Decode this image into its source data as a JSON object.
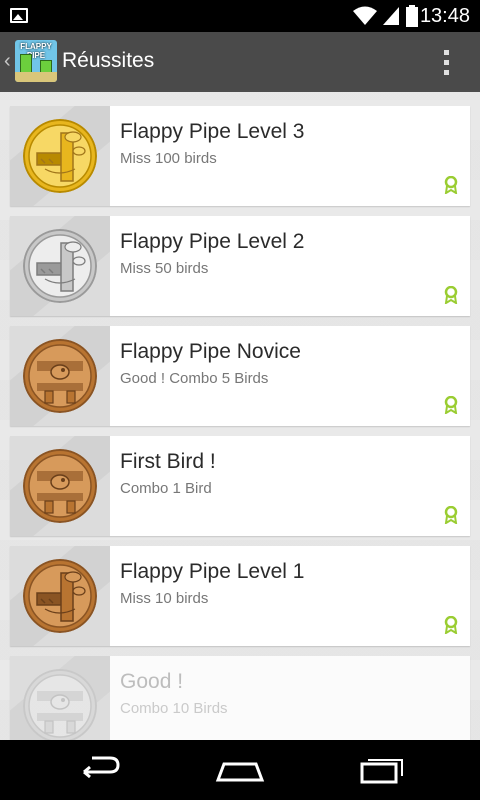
{
  "status_bar": {
    "time": "13:48",
    "icons": [
      "image-notification-icon",
      "wifi-icon",
      "signal-icon",
      "battery-icon"
    ]
  },
  "action_bar": {
    "title": "Réussites",
    "app_icon_text": "FLAPPY PIPE",
    "icons": [
      "up-caret-icon",
      "app-icon",
      "overflow-menu-icon"
    ]
  },
  "achievements": [
    {
      "name": "Flappy Pipe Level 3",
      "description": "Miss 100 birds",
      "medal": "gold",
      "unlocked": true
    },
    {
      "name": "Flappy Pipe Level 2",
      "description": "Miss 50 birds",
      "medal": "silver",
      "unlocked": true
    },
    {
      "name": "Flappy Pipe Novice",
      "description": "Good ! Combo 5 Birds",
      "medal": "bronze",
      "unlocked": true
    },
    {
      "name": "First Bird !",
      "description": "Combo 1 Bird",
      "medal": "bronze",
      "unlocked": true
    },
    {
      "name": "Flappy Pipe Level 1",
      "description": "Miss 10 birds",
      "medal": "bronze",
      "unlocked": true
    },
    {
      "name": "Good !",
      "description": "Combo 10 Birds",
      "medal": "grey",
      "unlocked": false
    }
  ],
  "nav_bar": {
    "buttons": [
      "back-icon",
      "home-icon",
      "recents-icon"
    ]
  },
  "colors": {
    "gold": "#e8b61e",
    "silver": "#c8c8c8",
    "bronze": "#b87431",
    "award": "#9acd32",
    "action_bar": "#4a4a4a"
  }
}
